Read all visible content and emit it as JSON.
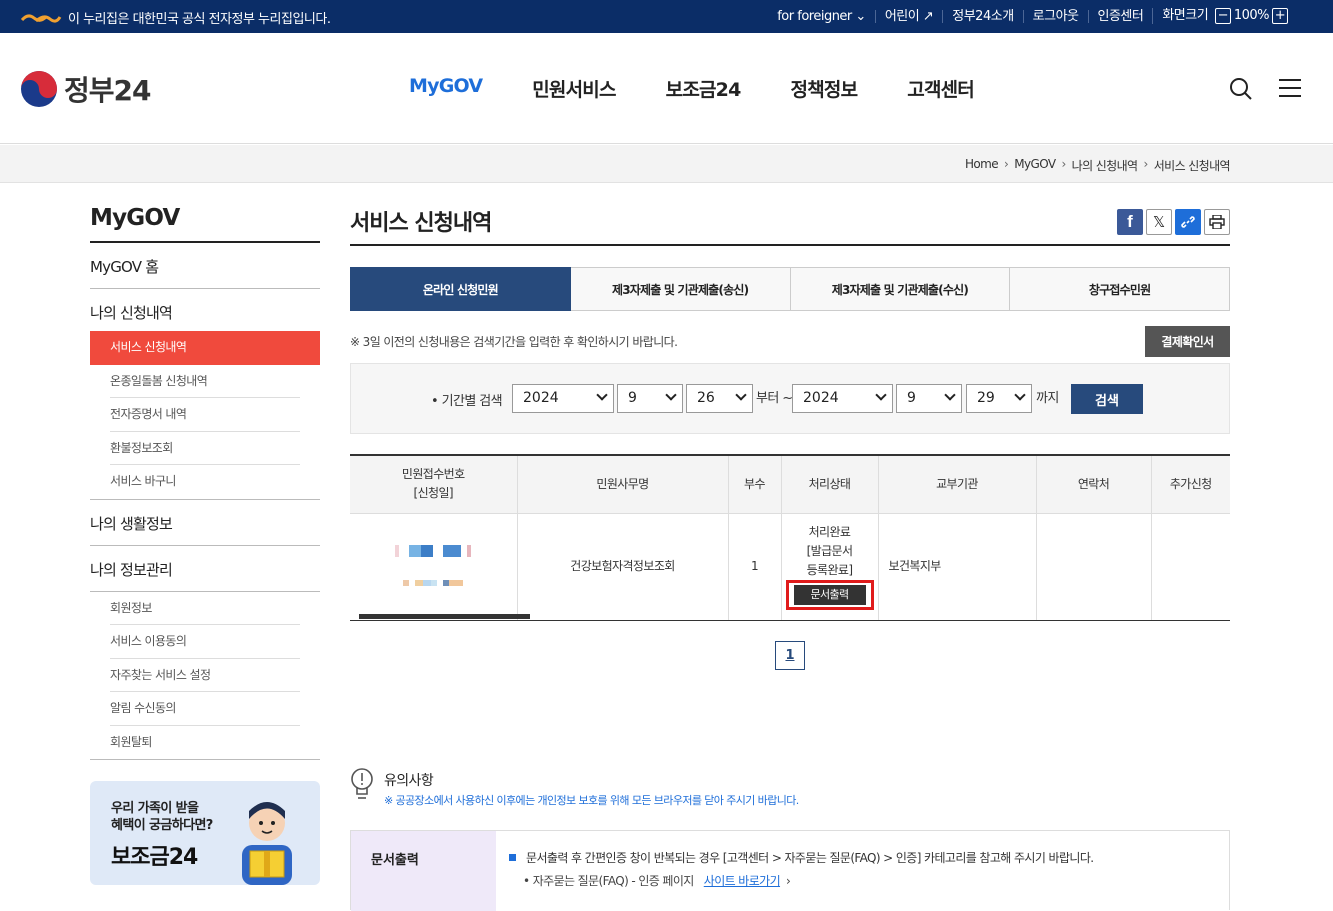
{
  "topbar": {
    "gov_notice": "이 누리집은 대한민국 공식 전자정부 누리집입니다.",
    "links": [
      "for foreigner",
      "어린이",
      "정부24소개",
      "로그아웃",
      "인증센터",
      "화면크기"
    ],
    "zoom": "100%"
  },
  "header": {
    "logo_text": "정부24",
    "nav": [
      "MyGOV",
      "민원서비스",
      "보조금24",
      "정책정보",
      "고객센터"
    ]
  },
  "breadcrumb": [
    "Home",
    "MyGOV",
    "나의 신청내역",
    "서비스 신청내역"
  ],
  "sidebar": {
    "title": "MyGOV",
    "home": "MyGOV 홈",
    "group1": "나의 신청내역",
    "group1_items": [
      "서비스 신청내역",
      "온종일돌봄 신청내역",
      "전자증명서 내역",
      "환불정보조회",
      "서비스 바구니"
    ],
    "group2": "나의 생활정보",
    "group3": "나의 정보관리",
    "group3_items": [
      "회원정보",
      "서비스 이용동의",
      "자주찾는 서비스 설정",
      "알림 수신동의",
      "회원탈퇴"
    ],
    "banner_line1": "우리 가족이 받을",
    "banner_line2": "혜택이 궁금하다면?",
    "banner_title": "보조금24"
  },
  "main": {
    "title": "서비스 신청내역",
    "tabs": [
      "온라인 신청민원",
      "제3자제출 및 기관제출(송신)",
      "제3자제출 및 기관제출(수신)",
      "창구접수민원"
    ],
    "notice": "※ 3일 이전의 신청내용은 검색기간을 입력한 후 확인하시기 바랍니다.",
    "pay_confirm": "결제확인서",
    "search": {
      "label": "기간별 검색",
      "from_year": "2024",
      "from_month": "9",
      "from_day": "26",
      "from_text": "부터 ~",
      "to_year": "2024",
      "to_month": "9",
      "to_day": "29",
      "to_text": "까지",
      "button": "검색"
    },
    "table": {
      "headers": [
        "민원접수번호",
        "[신청일]",
        "민원사무명",
        "부수",
        "처리상태",
        "교부기관",
        "연락처",
        "추가신청"
      ],
      "row": {
        "service": "건강보험자격정보조회",
        "copies": "1",
        "status1": "처리완료",
        "status2": "[발급문서",
        "status3": "등록완료]",
        "print": "문서출력",
        "agency": "보건복지부"
      }
    },
    "page": "1",
    "tips_title": "유의사항",
    "tips_text": "※ 공공장소에서 사용하신 이후에는 개인정보 보호를 위해 모든 브라우저를 닫아 주시기 바랍니다.",
    "doc_label": "문서출력",
    "doc_line1": "문서출력 후 간편인증 창이 반복되는 경우 [고객센터 > 자주묻는 질문(FAQ) > 인증] 카테고리를 참고해 주시기 바랍니다.",
    "doc_line2": "자주묻는 질문(FAQ) - 인증 페이지",
    "doc_link": "사이트 바로가기"
  },
  "colors": {
    "topbar": "#0b2d67",
    "accent": "#1e6ed9",
    "active_menu": "#f04a3d",
    "tab_on": "#274a7c",
    "highlight": "#e01b1b"
  }
}
